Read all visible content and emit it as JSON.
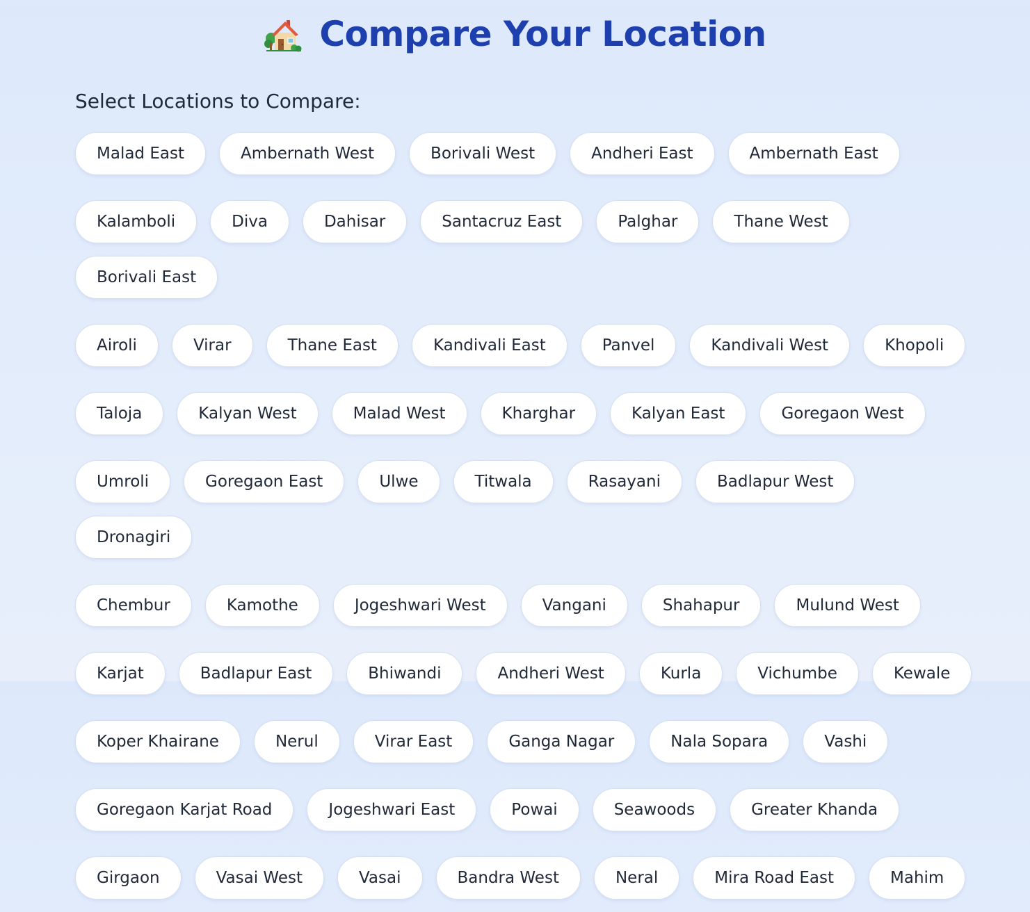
{
  "header": {
    "icon": "house-with-garden-icon",
    "title": "Compare Your Location"
  },
  "section": {
    "label": "Select Locations to Compare:"
  },
  "rows": [
    [
      "Malad East",
      "Ambernath West",
      "Borivali West",
      "Andheri East",
      "Ambernath East"
    ],
    [
      "Kalamboli",
      "Diva",
      "Dahisar",
      "Santacruz East",
      "Palghar",
      "Thane West",
      "Borivali East"
    ],
    [
      "Airoli",
      "Virar",
      "Thane East",
      "Kandivali East",
      "Panvel",
      "Kandivali West",
      "Khopoli"
    ],
    [
      "Taloja",
      "Kalyan West",
      "Malad West",
      "Kharghar",
      "Kalyan East",
      "Goregaon West"
    ],
    [
      "Umroli",
      "Goregaon East",
      "Ulwe",
      "Titwala",
      "Rasayani",
      "Badlapur West",
      "Dronagiri"
    ],
    [
      "Chembur",
      "Kamothe",
      "Jogeshwari West",
      "Vangani",
      "Shahapur",
      "Mulund West"
    ],
    [
      "Karjat",
      "Badlapur East",
      "Bhiwandi",
      "Andheri West",
      "Kurla",
      "Vichumbe",
      "Kewale"
    ],
    [
      "Koper Khairane",
      "Nerul",
      "Virar East",
      "Ganga Nagar",
      "Nala Sopara",
      "Vashi"
    ],
    [
      "Goregaon Karjat Road",
      "Jogeshwari East",
      "Powai",
      "Seawoods",
      "Greater Khanda"
    ],
    [
      "Girgaon",
      "Vasai West",
      "Vasai",
      "Bandra West",
      "Neral",
      "Mira Road East",
      "Mahim"
    ]
  ],
  "colors": {
    "title": "#1e40af",
    "background": "#dde9fb",
    "chip_bg": "#ffffff",
    "chip_border": "#d7e1ee",
    "text": "#1f2937"
  }
}
